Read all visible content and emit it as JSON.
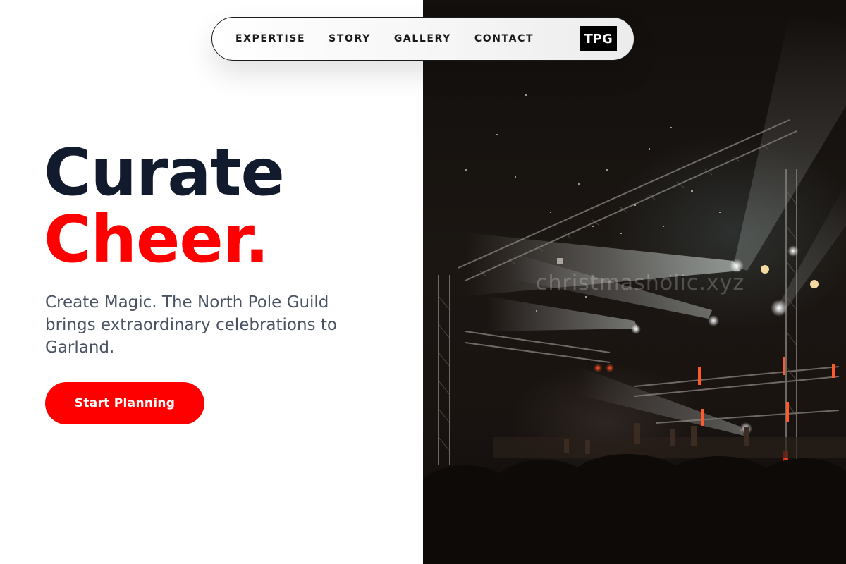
{
  "nav": {
    "links": [
      "EXPERTISE",
      "STORY",
      "GALLERY",
      "CONTACT"
    ],
    "logo": "TPG"
  },
  "hero": {
    "headline_line1": "Curate",
    "headline_line2": "Cheer.",
    "subtitle": "Create Magic. The North Pole Guild brings extraordinary celebrations to Garland.",
    "cta_label": "Start Planning"
  },
  "image": {
    "watermark": "christmasholic.xyz",
    "subject": "concert-stage-with-spotlights"
  },
  "colors": {
    "accent": "#ff0000",
    "headline": "#121a2e",
    "body_text": "#4a5362",
    "logo_bg": "#000000"
  }
}
